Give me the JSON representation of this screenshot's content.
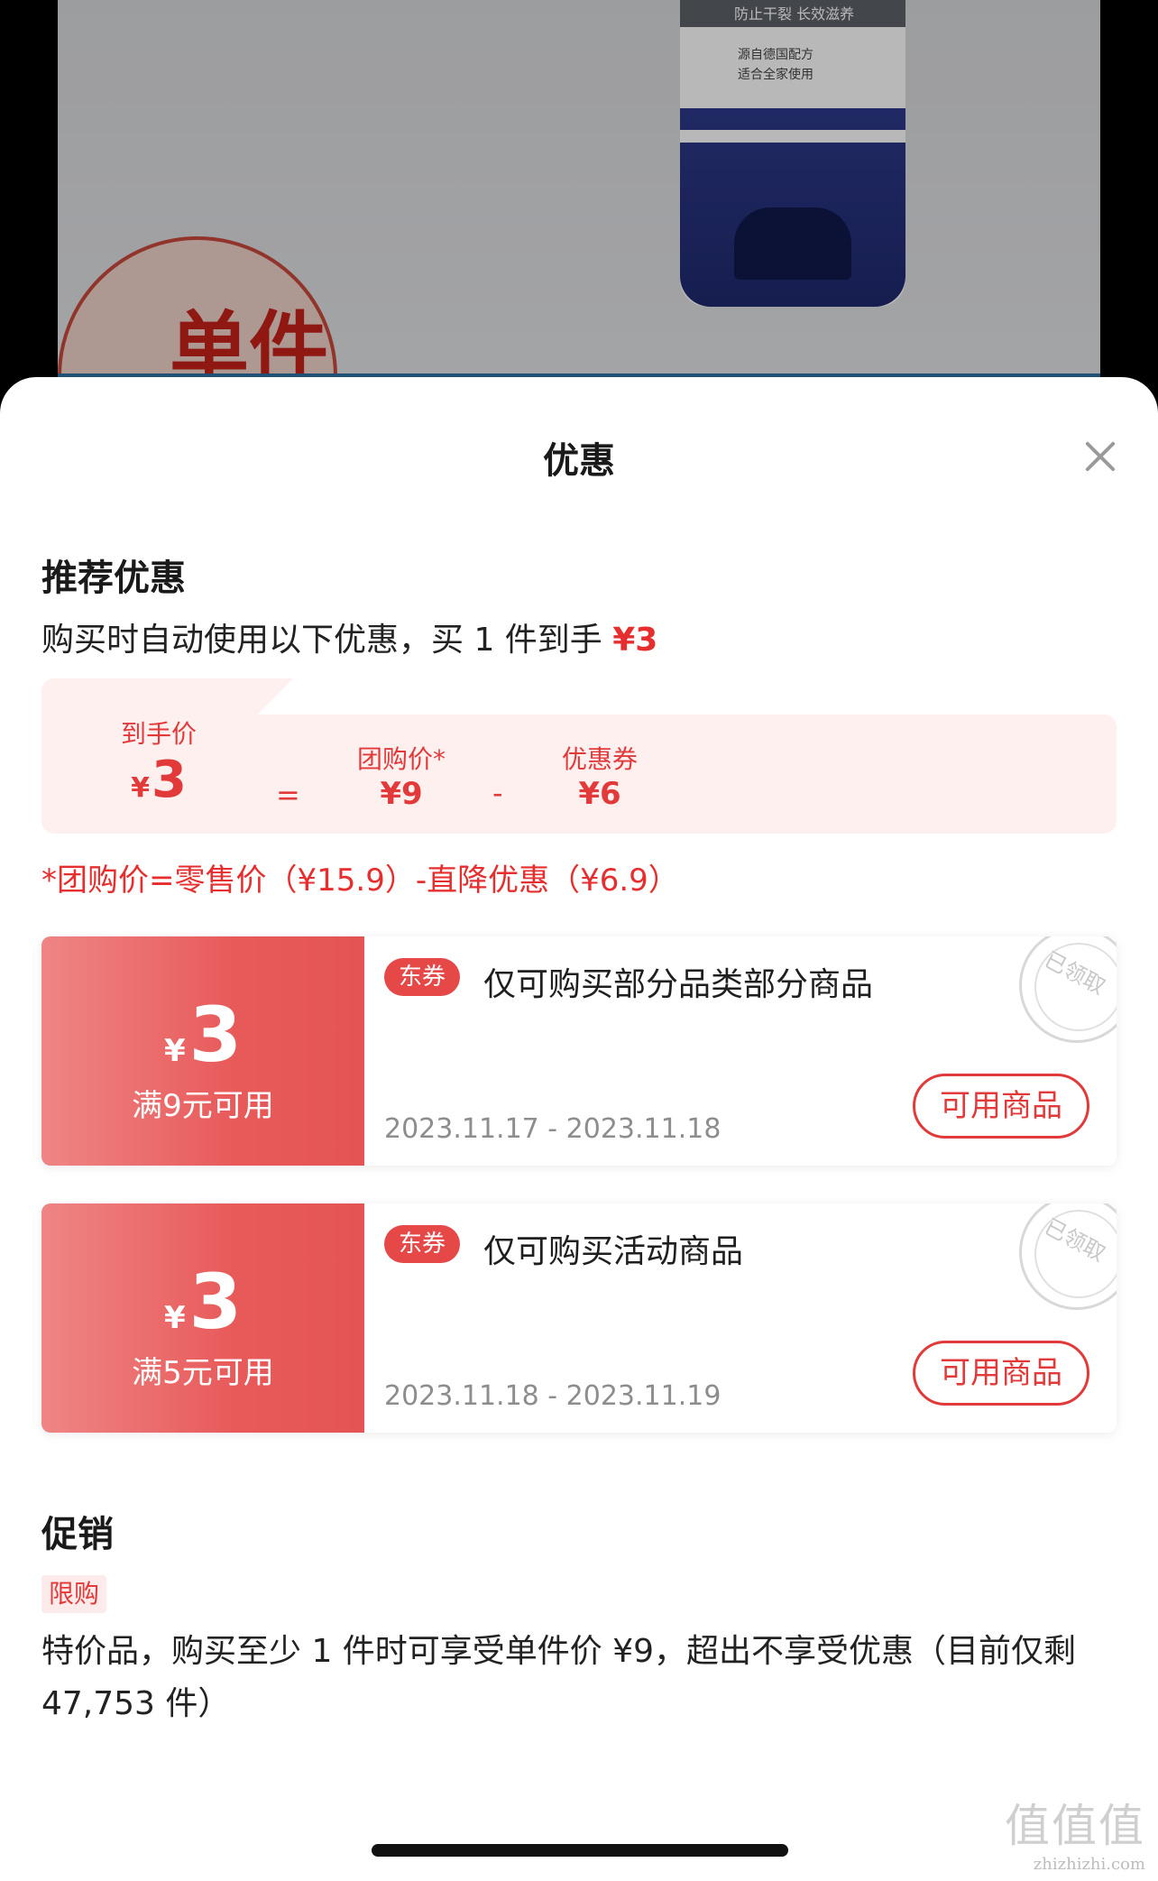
{
  "product": {
    "tube_band_text": "防止干裂 长效滋养",
    "tube_text_1": "源自德国配方",
    "tube_text_2": "适合全家使用",
    "badge_text": "单件"
  },
  "sheet": {
    "title": "优惠",
    "close_icon": "close-icon"
  },
  "recommend": {
    "title": "推荐优惠",
    "desc_prefix": "购买时自动使用以下优惠，买 1 件到手 ",
    "desc_price": "¥3"
  },
  "breakdown": {
    "final_label": "到手价",
    "final_currency": "¥",
    "final_value": "3",
    "eq": "=",
    "group_label": "团购价*",
    "group_value": "¥9",
    "minus": "-",
    "coupon_label": "优惠券",
    "coupon_value": "¥6",
    "footnote": "*团购价=零售价（¥15.9）-直降优惠（¥6.9）"
  },
  "coupons": [
    {
      "currency": "¥",
      "amount": "3",
      "condition": "满9元可用",
      "tag": "东券",
      "desc": "仅可购买部分品类部分商品",
      "date": "2023.11.17 - 2023.11.18",
      "button": "可用商品",
      "stamp": "已领取"
    },
    {
      "currency": "¥",
      "amount": "3",
      "condition": "满5元可用",
      "tag": "东券",
      "desc": "仅可购买活动商品",
      "date": "2023.11.18 - 2023.11.19",
      "button": "可用商品",
      "stamp": "已领取"
    }
  ],
  "promotion": {
    "title": "促销",
    "tag": "限购",
    "text": "特价品，购买至少 1 件时可享受单件价 ¥9，超出不享受优惠（目前仅剩 47,753 件）"
  },
  "watermark": {
    "big": "值值值",
    "small": "zhizhizhi.com"
  },
  "colors": {
    "accent": "#e62e2e",
    "coupon_gradient_start": "#ef8585",
    "coupon_gradient_end": "#e45454",
    "breakdown_bg": "#fff0f0"
  }
}
